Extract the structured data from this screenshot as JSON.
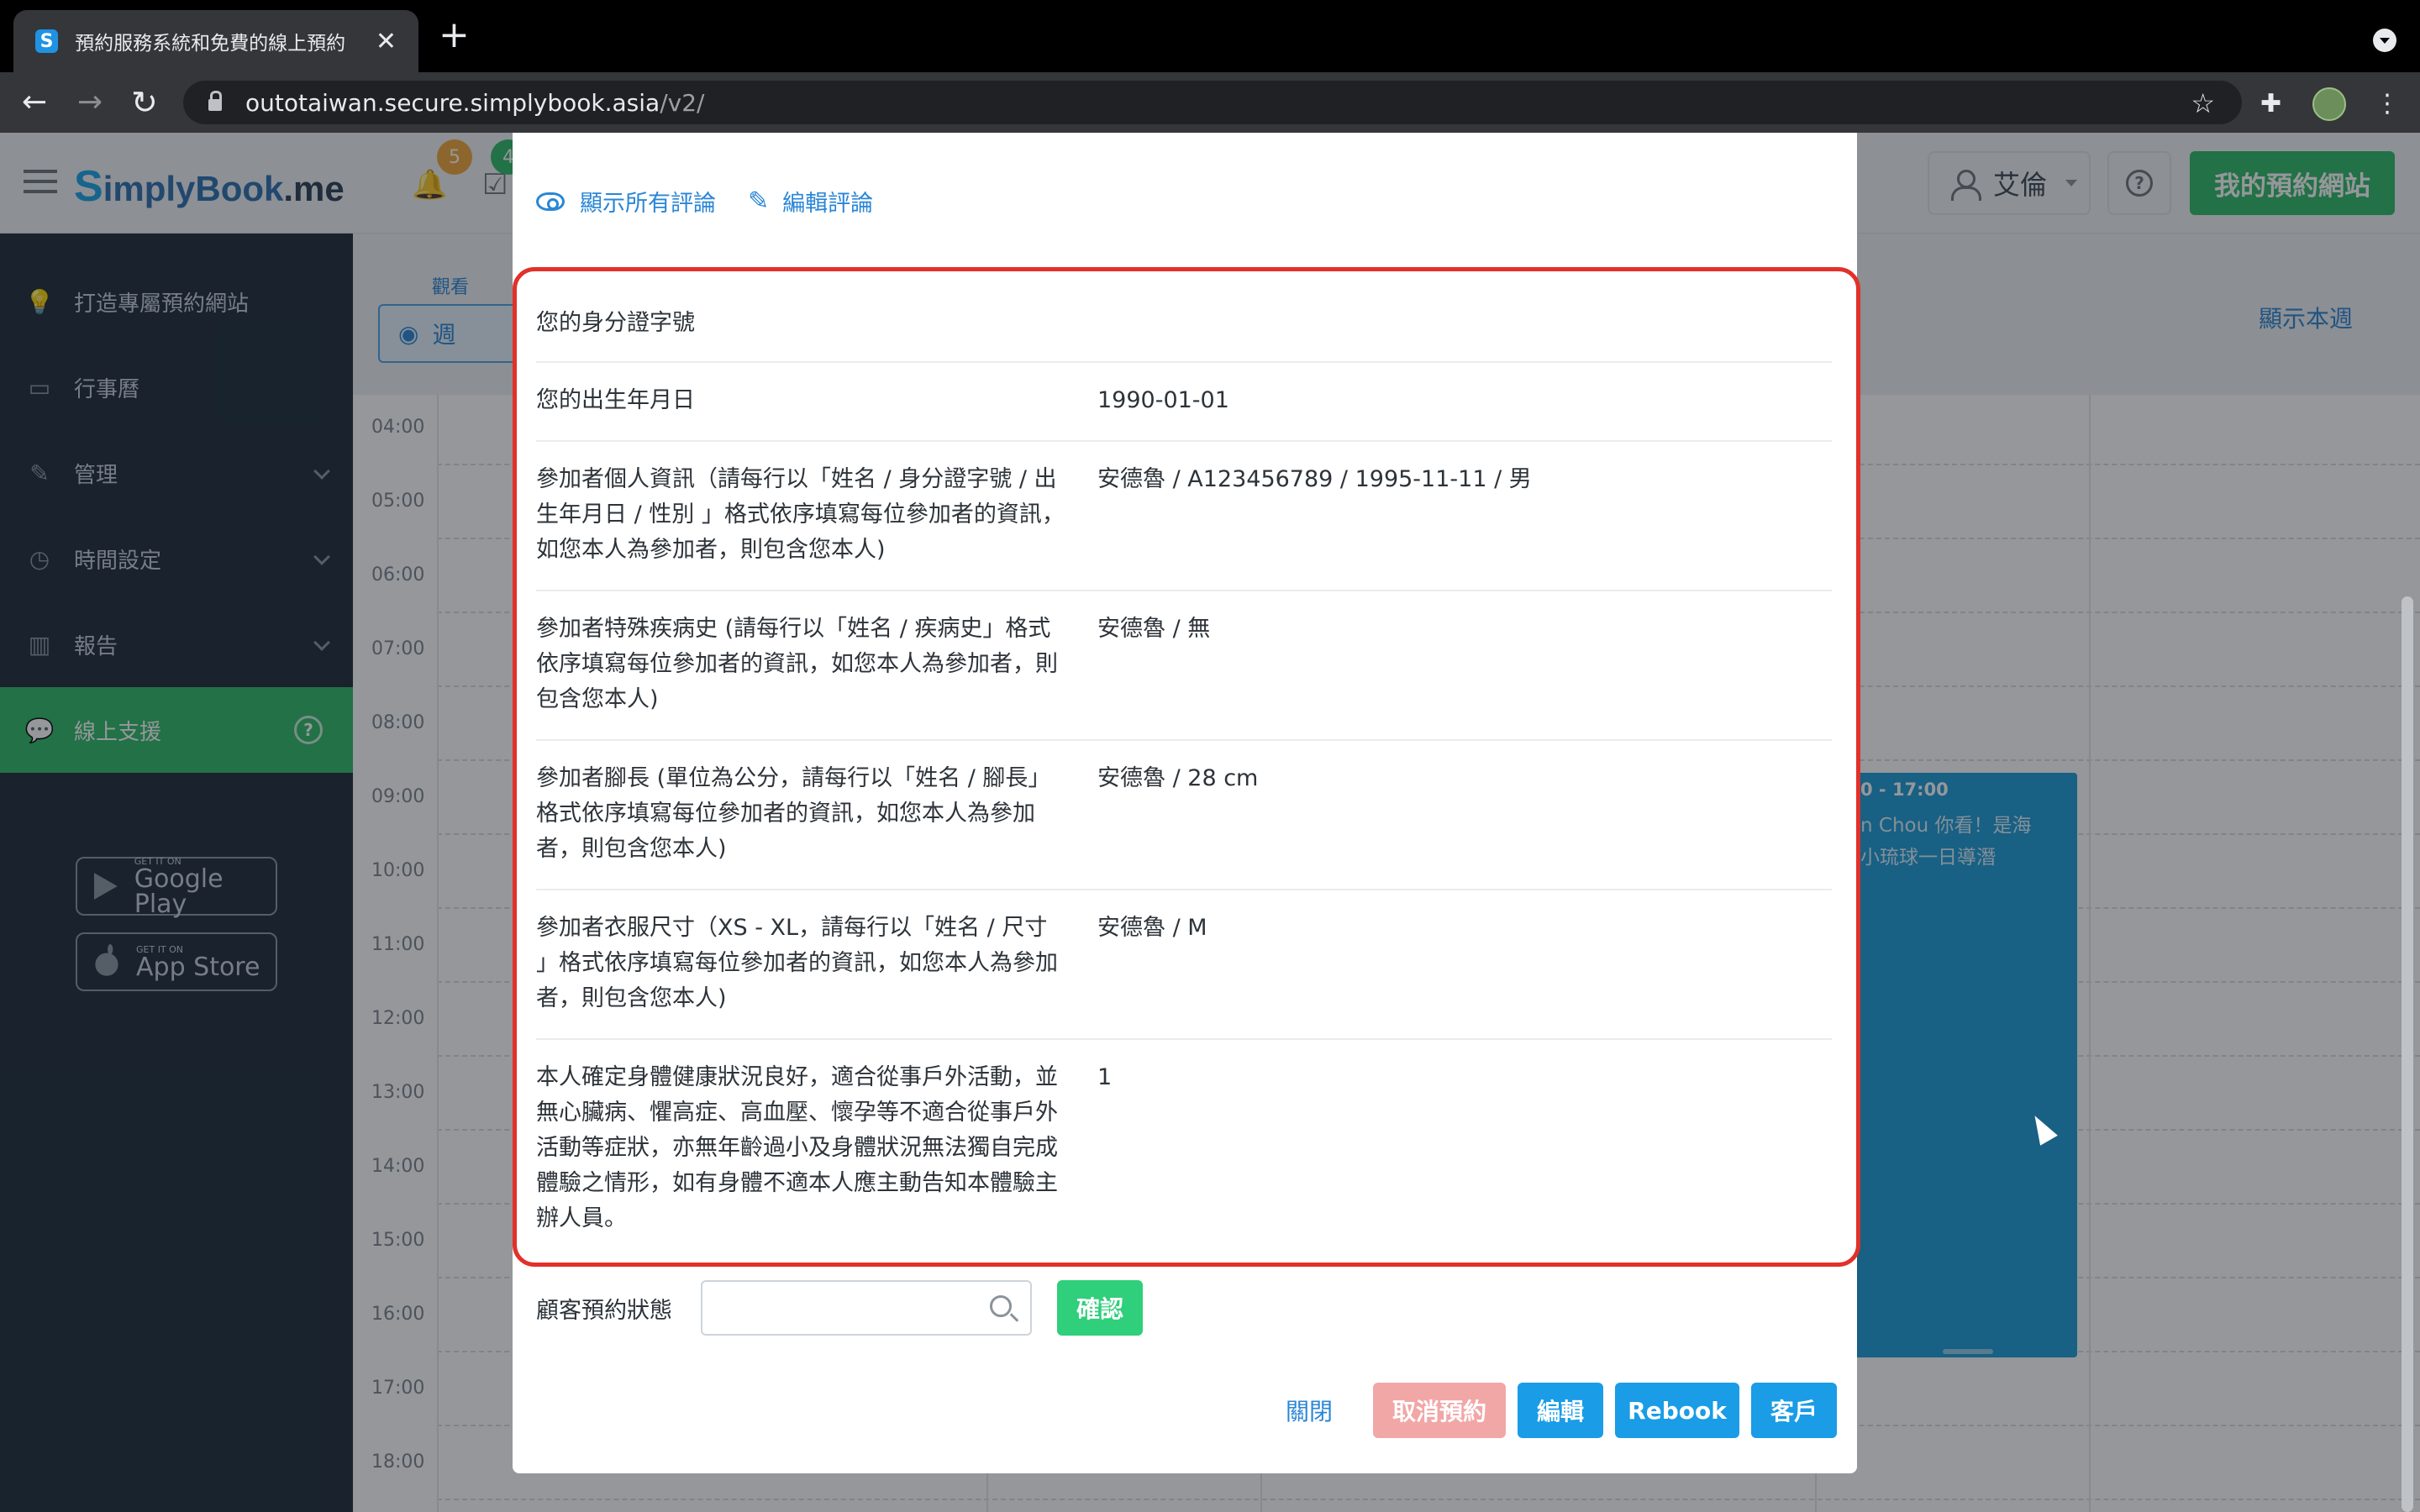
{
  "browser": {
    "tab_title": "預約服務系統和免費的線上預約",
    "favicon_letter": "S",
    "url_host": "outotaiwan.secure.simplybook.asia",
    "url_path": "/v2/"
  },
  "header": {
    "logo_prefix": "S",
    "logo_main": "implyBook",
    "logo_suffix": ".me",
    "notification_count": "5",
    "calendar_count": "4",
    "user_name": "艾倫",
    "site_button": "我的預約網站",
    "accent_color": "#2fbb68"
  },
  "sidebar": {
    "items": [
      {
        "label": "打造專屬預約網站",
        "icon": "lightbulb-icon"
      },
      {
        "label": "行事曆",
        "icon": "calendar-icon"
      },
      {
        "label": "管理",
        "icon": "pencil-icon"
      },
      {
        "label": "時間設定",
        "icon": "clock-icon"
      },
      {
        "label": "報告",
        "icon": "bar-chart-icon"
      },
      {
        "label": "線上支援",
        "icon": "chat-icon"
      }
    ],
    "google_play_small": "GET IT ON",
    "google_play": "Google Play",
    "app_store_small": "GET IT ON",
    "app_store": "App Store"
  },
  "calendar": {
    "view_label": "觀看",
    "view_value": "週",
    "show_week": "顯示本週",
    "times": [
      "04:00",
      "05:00",
      "06:00",
      "07:00",
      "08:00",
      "09:00",
      "10:00",
      "11:00",
      "12:00",
      "13:00",
      "14:00",
      "15:00",
      "16:00",
      "17:00",
      "18:00"
    ],
    "event_time": "0 - 17:00",
    "event_title_1": "n Chou 你看！是海",
    "event_title_2": "小琉球一日導潛"
  },
  "modal": {
    "show_all_reviews": "顯示所有評論",
    "edit_review": "編輯評論",
    "rows": [
      {
        "label": "您的身分證字號",
        "value": ""
      },
      {
        "label": "您的出生年月日",
        "value": "1990-01-01"
      },
      {
        "label": "參加者個人資訊（請每行以「姓名 / 身分證字號 / 出生年月日 / 性別 」格式依序填寫每位參加者的資訊，如您本人為參加者，則包含您本人)",
        "value": "安德魯 / A123456789 / 1995-11-11 / 男"
      },
      {
        "label": "參加者特殊疾病史 (請每行以「姓名 / 疾病史」格式依序填寫每位參加者的資訊，如您本人為參加者，則包含您本人)",
        "value": "安德魯 / 無"
      },
      {
        "label": "參加者腳長 (單位為公分，請每行以「姓名 / 腳長」格式依序填寫每位參加者的資訊，如您本人為參加者，則包含您本人)",
        "value": "安德魯 / 28 cm"
      },
      {
        "label": "參加者衣服尺寸（XS - XL，請每行以「姓名 / 尺寸 」格式依序填寫每位參加者的資訊，如您本人為參加者，則包含您本人)",
        "value": "安德魯 / M"
      },
      {
        "label": "本人確定身體健康狀況良好，適合從事戶外活動，並無心臟病、懼高症、高血壓、懷孕等不適合從事戶外活動等症狀，亦無年齡過小及身體狀況無法獨自完成體驗之情形，如有身體不適本人應主動告知本體驗主辦人員。",
        "value": "1"
      }
    ],
    "status_label": "顧客預約狀態",
    "status_value": "",
    "confirm": "確認",
    "buttons": {
      "close": "關閉",
      "cancel_booking": "取消預約",
      "edit": "編輯",
      "rebook": "Rebook",
      "client": "客戶"
    },
    "highlight_color": "#e1312a"
  }
}
